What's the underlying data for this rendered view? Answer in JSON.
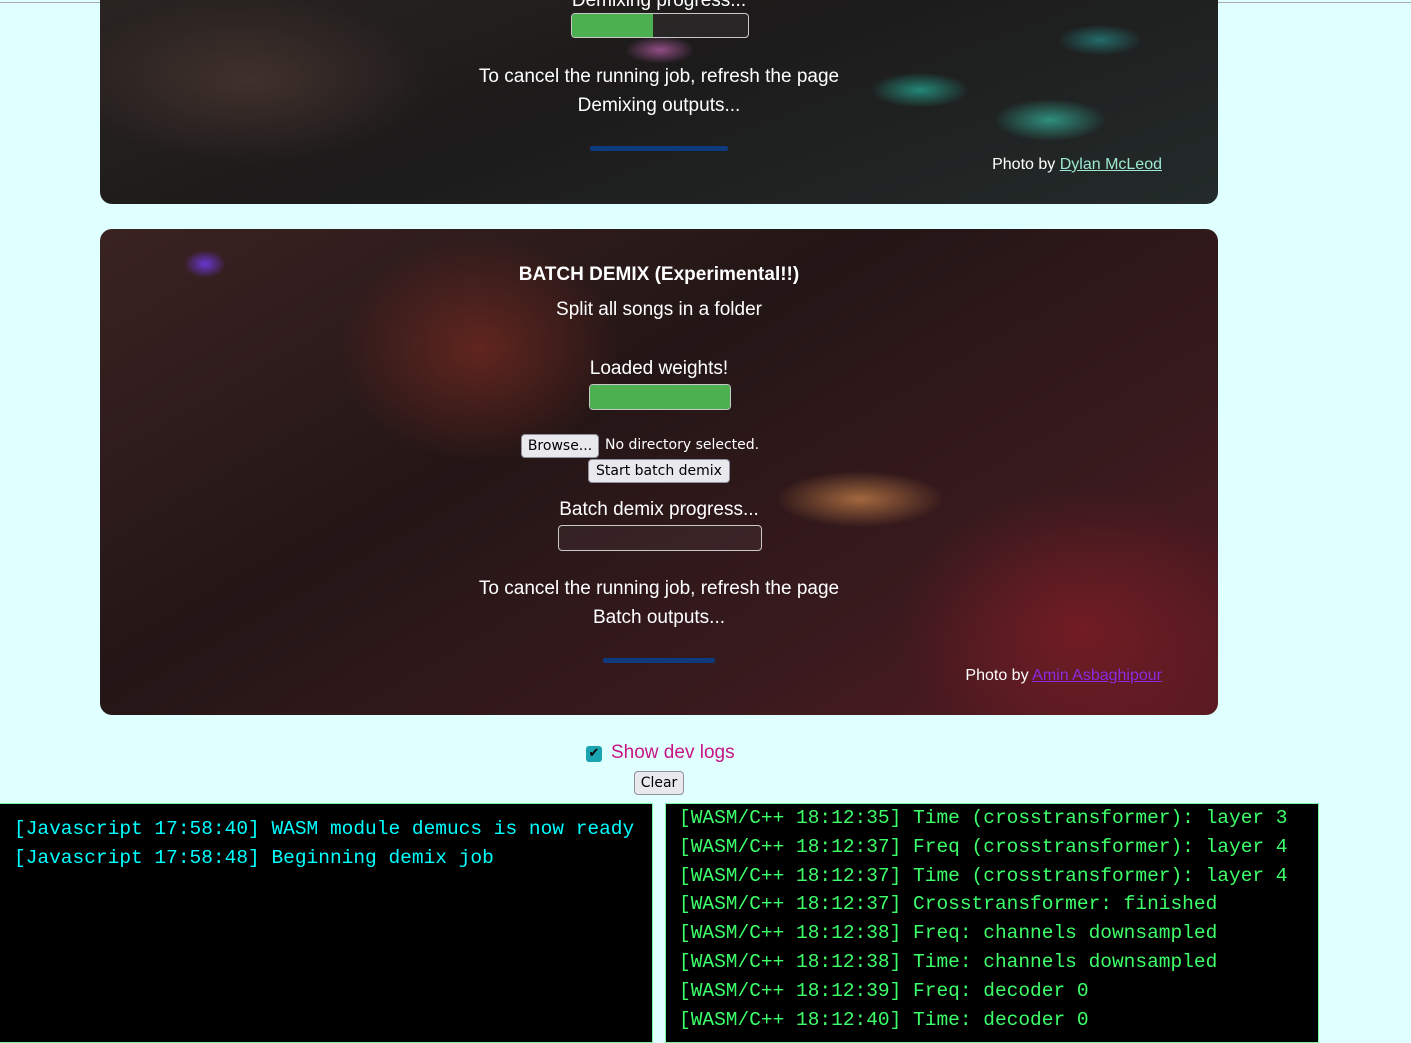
{
  "demix": {
    "progress_label": "Demixing progress...",
    "progress_fraction": 0.46,
    "cancel_note": "To cancel the running job, refresh the page",
    "outputs_label": "Demixing outputs...",
    "photo_credit_prefix": "Photo by",
    "photo_credit_name": "Dylan McLeod"
  },
  "batch": {
    "title": "BATCH DEMIX (Experimental!!)",
    "subtitle": "Split all songs in a folder",
    "weights_label": "Loaded weights!",
    "weights_progress_fraction": 1.0,
    "browse_label": "Browse...",
    "directory_status": "No directory selected.",
    "start_label": "Start batch demix",
    "progress_label": "Batch demix progress...",
    "progress_fraction": 0,
    "cancel_note": "To cancel the running job, refresh the page",
    "outputs_label": "Batch outputs...",
    "photo_credit_prefix": "Photo by",
    "photo_credit_name": "Amin Asbaghipour"
  },
  "dev": {
    "show_logs_label": "Show dev logs",
    "show_logs_checked": true,
    "clear_label": "Clear"
  },
  "logs": {
    "javascript": [
      "[Javascript 17:58:40] WASM module demucs is now ready",
      "[Javascript 17:58:48] Beginning demix job"
    ],
    "wasm": [
      "[WASM/C++ 18:12:35] Time (crosstransformer): layer 3",
      "[WASM/C++ 18:12:37] Freq (crosstransformer): layer 4",
      "[WASM/C++ 18:12:37] Time (crosstransformer): layer 4",
      "[WASM/C++ 18:12:37] Crosstransformer: finished",
      "[WASM/C++ 18:12:38] Freq: channels downsampled",
      "[WASM/C++ 18:12:38] Time: channels downsampled",
      "[WASM/C++ 18:12:39] Freq: decoder 0",
      "[WASM/C++ 18:12:40] Time: decoder 0"
    ]
  },
  "colors": {
    "page_background": "#e0ffff",
    "progress_fill": "#4caf50",
    "output_bar": "#0d3a7c",
    "dev_label": "#c71585",
    "log_js_text": "#00ffff",
    "log_wasm_text": "#3dff6a"
  }
}
